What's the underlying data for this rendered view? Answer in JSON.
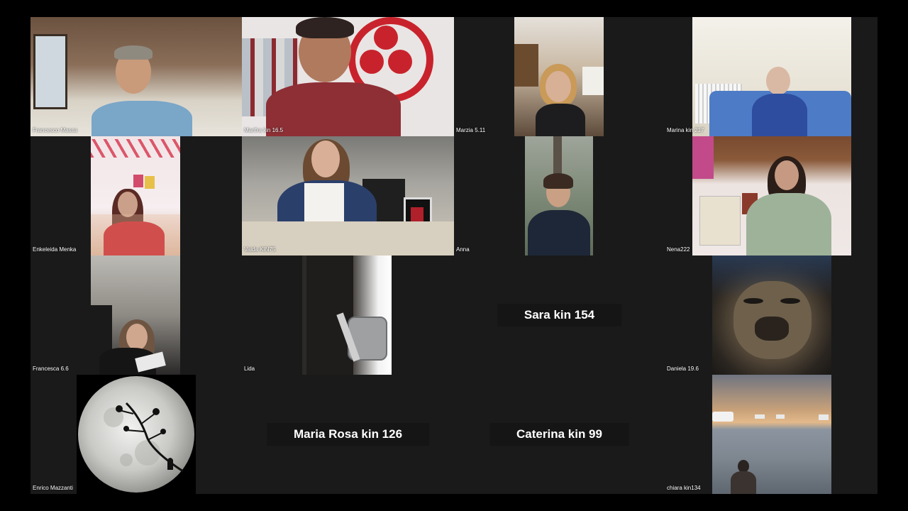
{
  "participants": [
    {
      "name": "Francesco Massa",
      "video": true
    },
    {
      "name": "Marifra kin 16.5",
      "video": true
    },
    {
      "name": "Marzia 5.11",
      "video": true
    },
    {
      "name": "Marina kin 217",
      "video": true
    },
    {
      "name": "Enkeleida Menka",
      "video": true
    },
    {
      "name": "Vaida KIN75",
      "video": true
    },
    {
      "name": "Anna",
      "video": true
    },
    {
      "name": "Nena222",
      "video": true
    },
    {
      "name": "Francesca 6.6",
      "video": true
    },
    {
      "name": "Lida",
      "video": true
    },
    {
      "name": "Sara kin 154",
      "video": false
    },
    {
      "name": "Daniela 19.6",
      "video": true
    },
    {
      "name": "Enrico Mazzanti",
      "video": true
    },
    {
      "name": "Maria Rosa kin 126",
      "video": false
    },
    {
      "name": "Caterina kin 99",
      "video": false
    },
    {
      "name": "chiara kin134",
      "video": true
    }
  ],
  "colors": {
    "background": "#000000",
    "tile": "#1a1a1a",
    "name_plate": "#151515",
    "text": "#ffffff"
  }
}
